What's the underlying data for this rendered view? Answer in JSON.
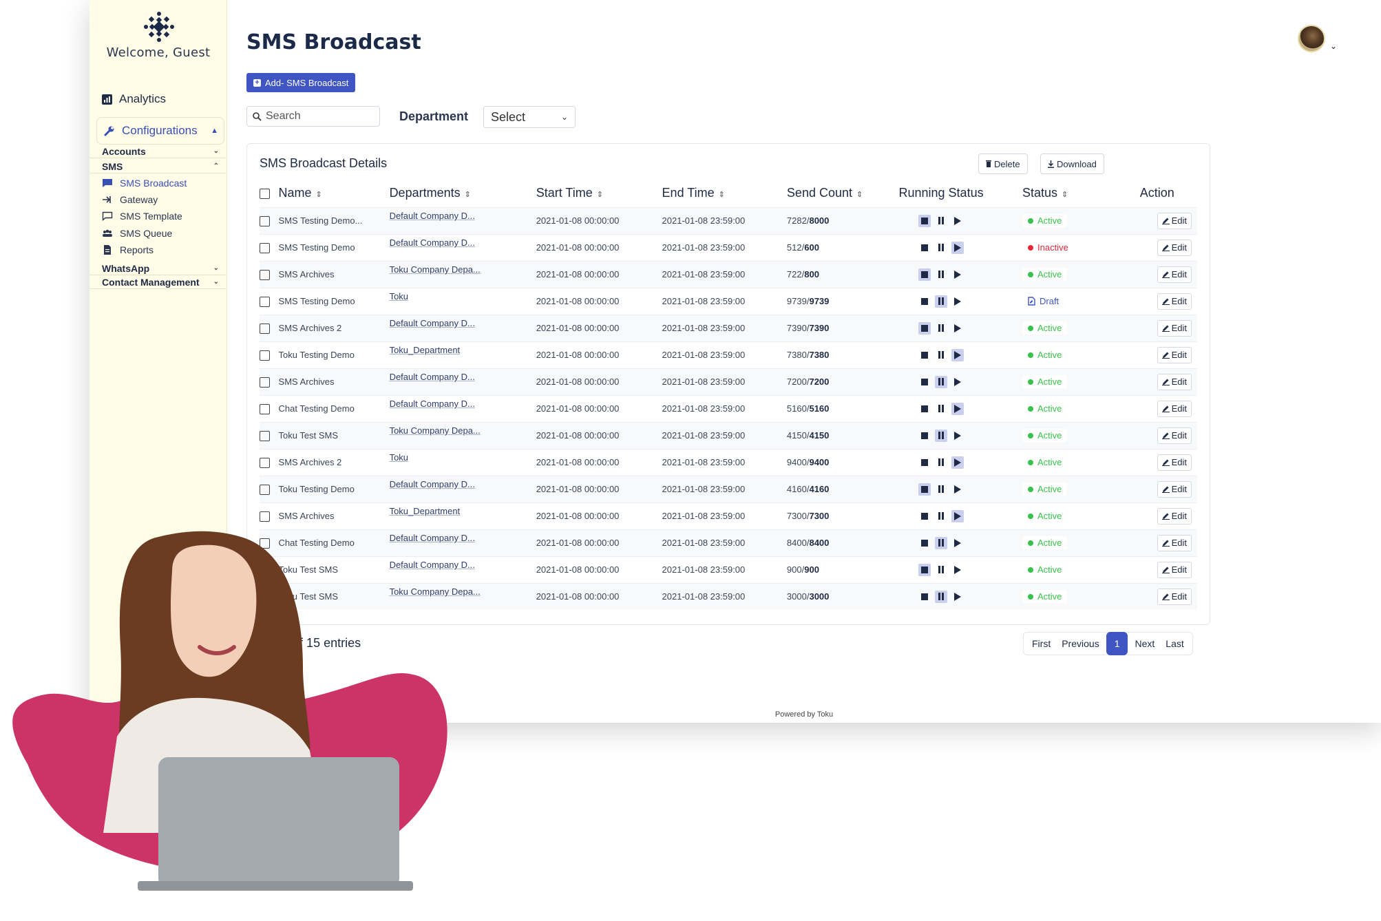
{
  "sidebar": {
    "welcome": "Welcome, Guest",
    "analytics": "Analytics",
    "configurations": "Configurations",
    "groups": {
      "accounts": "Accounts",
      "sms": "SMS",
      "whatsapp": "WhatsApp",
      "contact": "Contact Management"
    },
    "sms_items": [
      "SMS Broadcast",
      "Gateway",
      "SMS Template",
      "SMS Queue",
      "Reports"
    ]
  },
  "header": {
    "title": "SMS Broadcast",
    "add_button": "Add- SMS Broadcast",
    "search_placeholder": "Search",
    "department_label": "Department",
    "department_select": "Select"
  },
  "card": {
    "title": "SMS Broadcast Details",
    "delete": "Delete",
    "download": "Download"
  },
  "table": {
    "headers": [
      "Name",
      "Departments",
      "Start Time",
      "End Time",
      "Send Count",
      "Running Status",
      "Status",
      "Action"
    ],
    "edit_label": "Edit",
    "rows": [
      {
        "name": "SMS Testing Demo...",
        "dept": "Default Company D...",
        "start": "2021-01-08 00:00:00",
        "end": "2021-01-08 23:59:00",
        "sent": "7282",
        "total": "8000",
        "running": "stop",
        "status": "Active"
      },
      {
        "name": "SMS Testing Demo",
        "dept": "Default Company D...",
        "start": "2021-01-08 00:00:00",
        "end": "2021-01-08 23:59:00",
        "sent": "512",
        "total": "600",
        "running": "play",
        "status": "Inactive"
      },
      {
        "name": "SMS Archives",
        "dept": "Toku Company Depa...",
        "start": "2021-01-08 00:00:00",
        "end": "2021-01-08 23:59:00",
        "sent": "722",
        "total": "800",
        "running": "stop",
        "status": "Active"
      },
      {
        "name": "SMS Testing Demo",
        "dept": "Toku",
        "start": "2021-01-08 00:00:00",
        "end": "2021-01-08 23:59:00",
        "sent": "9739",
        "total": "9739",
        "running": "pause",
        "status": "Draft"
      },
      {
        "name": "SMS Archives 2",
        "dept": "Default Company D...",
        "start": "2021-01-08 00:00:00",
        "end": "2021-01-08 23:59:00",
        "sent": "7390",
        "total": "7390",
        "running": "stop",
        "status": "Active"
      },
      {
        "name": "Toku Testing Demo",
        "dept": "Toku_Department",
        "start": "2021-01-08 00:00:00",
        "end": "2021-01-08 23:59:00",
        "sent": "7380",
        "total": "7380",
        "running": "play",
        "status": "Active"
      },
      {
        "name": "SMS Archives",
        "dept": "Default Company D...",
        "start": "2021-01-08 00:00:00",
        "end": "2021-01-08 23:59:00",
        "sent": "7200",
        "total": "7200",
        "running": "pause",
        "status": "Active"
      },
      {
        "name": "Chat Testing Demo",
        "dept": "Default Company D...",
        "start": "2021-01-08 00:00:00",
        "end": "2021-01-08 23:59:00",
        "sent": "5160",
        "total": "5160",
        "running": "play",
        "status": "Active"
      },
      {
        "name": "Toku Test SMS",
        "dept": "Toku Company Depa...",
        "start": "2021-01-08 00:00:00",
        "end": "2021-01-08 23:59:00",
        "sent": "4150",
        "total": "4150",
        "running": "pause",
        "status": "Active"
      },
      {
        "name": "SMS Archives 2",
        "dept": "Toku",
        "start": "2021-01-08 00:00:00",
        "end": "2021-01-08 23:59:00",
        "sent": "9400",
        "total": "9400",
        "running": "play",
        "status": "Active"
      },
      {
        "name": "Toku Testing Demo",
        "dept": "Default Company D...",
        "start": "2021-01-08 00:00:00",
        "end": "2021-01-08 23:59:00",
        "sent": "4160",
        "total": "4160",
        "running": "stop",
        "status": "Active"
      },
      {
        "name": "SMS Archives",
        "dept": "Toku_Department",
        "start": "2021-01-08 00:00:00",
        "end": "2021-01-08 23:59:00",
        "sent": "7300",
        "total": "7300",
        "running": "play",
        "status": "Active"
      },
      {
        "name": "Chat Testing Demo",
        "dept": "Default Company D...",
        "start": "2021-01-08 00:00:00",
        "end": "2021-01-08 23:59:00",
        "sent": "8400",
        "total": "8400",
        "running": "pause",
        "status": "Active"
      },
      {
        "name": "Toku Test SMS",
        "dept": "Default Company D...",
        "start": "2021-01-08 00:00:00",
        "end": "2021-01-08 23:59:00",
        "sent": "900",
        "total": "900",
        "running": "stop",
        "status": "Active"
      },
      {
        "name": "Toku Test SMS",
        "dept": "Toku Company Depa...",
        "start": "2021-01-08 00:00:00",
        "end": "2021-01-08 23:59:00",
        "sent": "3000",
        "total": "3000",
        "running": "pause",
        "status": "Active"
      }
    ]
  },
  "footer": {
    "entries": "1 to 15 of 15 entries",
    "pager": {
      "first": "First",
      "previous": "Previous",
      "current": "1",
      "next": "Next",
      "last": "Last"
    },
    "powered": "Powered by Toku"
  },
  "colors": {
    "accent": "#3f55c4",
    "active": "#38c24b",
    "inactive": "#e5283a",
    "draft": "#3f55c4",
    "sidebar_bg": "#fffde8",
    "blob": "#cc3366"
  }
}
